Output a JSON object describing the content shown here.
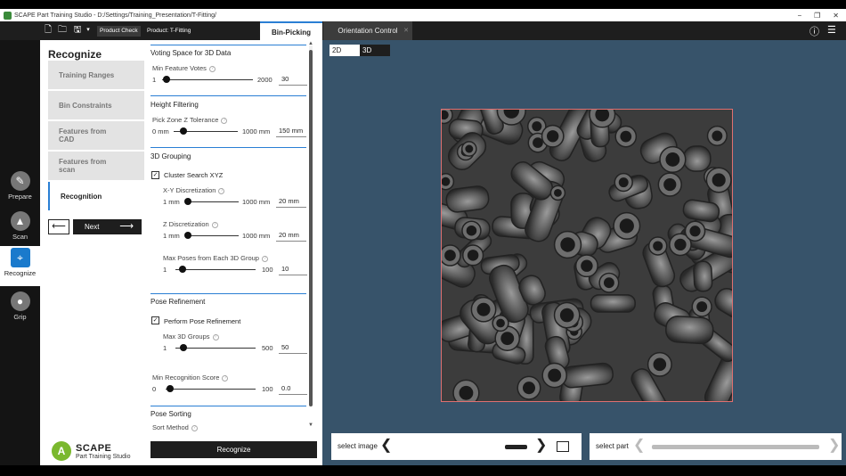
{
  "window": {
    "title": "SCAPE Part Training Studio - D:/Settings/Training_Presentation/T-Fitting/",
    "controls": [
      "−",
      "❐",
      "✕"
    ]
  },
  "toolbar": {
    "product_check": "Product Check",
    "product_label": "Product: T-Fitting",
    "tabs": [
      {
        "label": "Bin-Picking"
      },
      {
        "label": "Orientation Control"
      }
    ]
  },
  "rail": {
    "items": [
      {
        "label": "Prepare"
      },
      {
        "label": "Scan"
      },
      {
        "label": "Recognize"
      },
      {
        "label": "Grip"
      }
    ]
  },
  "steps": {
    "title": "Recognize",
    "items": [
      {
        "label": "Training Ranges"
      },
      {
        "label": "Bin Constraints"
      },
      {
        "label": "Features from CAD"
      },
      {
        "label": "Features from scan"
      },
      {
        "label": "Recognition"
      }
    ],
    "next_label": "Next"
  },
  "logo": {
    "mark": "A",
    "name": "SCAPE",
    "subtitle": "Part Training Studio"
  },
  "panel": {
    "voting": {
      "title": "Voting Space for 3D Data",
      "min_feature_votes": {
        "label": "Min Feature Votes",
        "min": "1",
        "max": "2000",
        "value": "30",
        "fraction": 0.015
      }
    },
    "height": {
      "title": "Height Filtering",
      "tolerance": {
        "label": "Pick Zone Z Tolerance",
        "min": "0 mm",
        "max": "1000 mm",
        "value": "150 mm",
        "fraction": 0.15
      }
    },
    "grouping": {
      "title": "3D Grouping",
      "cluster_label": "Cluster Search XYZ",
      "xy": {
        "label": "X-Y Discretization",
        "min": "1 mm",
        "max": "1000 mm",
        "value": "20 mm",
        "fraction": 0.019
      },
      "z": {
        "label": "Z Discretization",
        "min": "1 mm",
        "max": "1000 mm",
        "value": "20 mm",
        "fraction": 0.019
      },
      "max_poses": {
        "label": "Max Poses from Each 3D Group",
        "min": "1",
        "max": "100",
        "value": "10",
        "fraction": 0.09
      }
    },
    "refinement": {
      "title": "Pose Refinement",
      "perform_label": "Perform Pose Refinement",
      "max_groups": {
        "label": "Max 3D Groups",
        "min": "1",
        "max": "500",
        "value": "50",
        "fraction": 0.098
      }
    },
    "score": {
      "label": "Min Recognition Score",
      "min": "0",
      "max": "100",
      "value": "0.0",
      "fraction": 0.0
    },
    "sorting": {
      "title": "Pose Sorting",
      "method_label": "Sort Method"
    },
    "recognize_button": "Recognize"
  },
  "viewer": {
    "toggle_2d": "2D",
    "toggle_3d": "3D",
    "select_image": "select image",
    "select_part": "select part"
  }
}
